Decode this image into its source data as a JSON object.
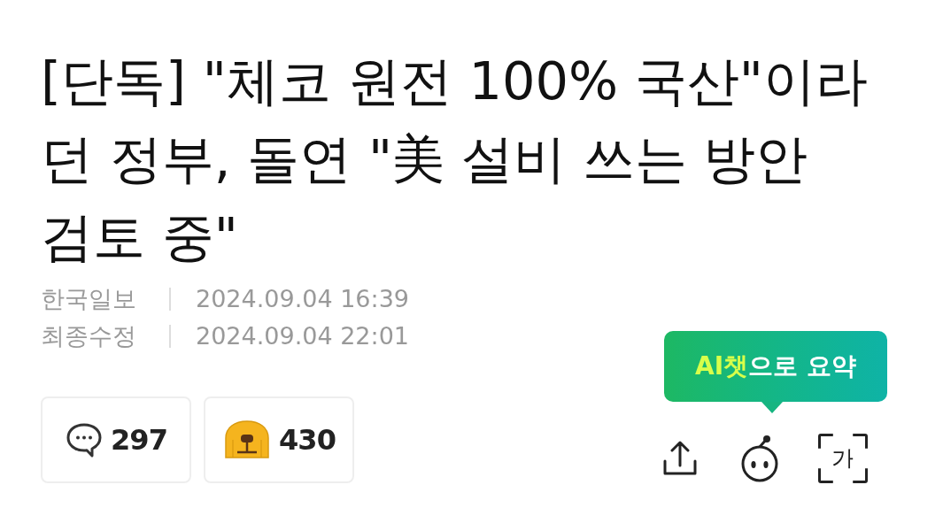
{
  "headline": "[단독] \"체코 원전 100% 국산\"이라던 정부, 돌연 \"美 설비 쓰는 방안 검토 중\"",
  "meta": [
    {
      "label": "한국일보",
      "date": "2024.09.04 16:39"
    },
    {
      "label": "최종수정",
      "date": "2024.09.04 22:01"
    }
  ],
  "reactions": [
    {
      "kind": "comment",
      "count": "297"
    },
    {
      "kind": "emoji",
      "count": "430"
    }
  ],
  "ai_tooltip": {
    "highlight": "AI챗",
    "rest": "으로 요약"
  },
  "toolbar": [
    {
      "kind": "share"
    },
    {
      "kind": "bot"
    },
    {
      "kind": "font",
      "label": "가"
    }
  ]
}
